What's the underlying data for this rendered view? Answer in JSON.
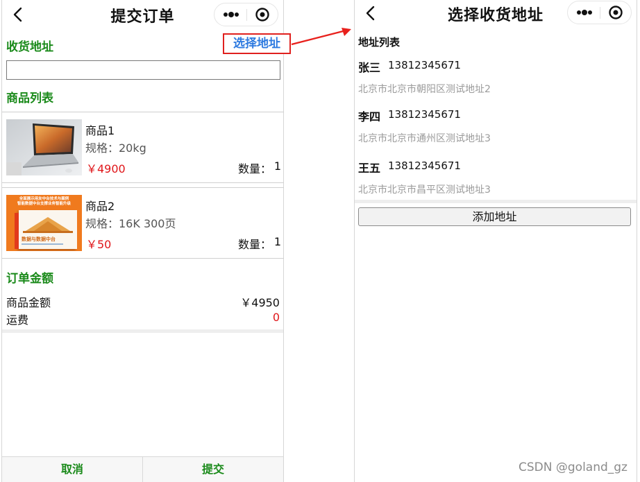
{
  "left_page": {
    "nav_title": "提交订单",
    "address_section_title": "收货地址",
    "select_address_label": "选择地址",
    "address_input_value": "",
    "products_section_title": "商品列表",
    "products": [
      {
        "name": "商品1",
        "spec": "规格：20kg",
        "price": "￥4900",
        "qty_label": "数量：",
        "qty": "1",
        "image": "laptop-image"
      },
      {
        "name": "商品2",
        "spec": "规格：16K 300页",
        "price": "￥50",
        "qty_label": "数量：",
        "qty": "1",
        "image": "book-cover-image"
      }
    ],
    "amount_section_title": "订单金额",
    "goods_amount_label": "商品金额",
    "goods_amount_value": "￥4950",
    "shipping_label": "运费",
    "shipping_value": "0",
    "cancel_label": "取消",
    "submit_label": "提交"
  },
  "right_page": {
    "nav_title": "选择收货地址",
    "list_heading": "地址列表",
    "addresses": [
      {
        "name": "张三",
        "phone": "13812345671",
        "detail": "北京市北京市朝阳区测试地址2"
      },
      {
        "name": "李四",
        "phone": "13812345671",
        "detail": "北京市北京市通州区测试地址3"
      },
      {
        "name": "王五",
        "phone": "13812345671",
        "detail": "北京市北京市昌平区测试地址3"
      }
    ],
    "add_address_label": "添加地址"
  },
  "book_cover_text": {
    "line1": "全面展示用友中台技术与案例",
    "line2": "智能数据中台支撑业务智能升级",
    "title": "数据与数据中台"
  },
  "colors": {
    "section_green": "#1a8a1a",
    "price_red": "#e0161a",
    "link_blue": "#2f7be0",
    "highlight_red": "#e0201e",
    "muted_gray": "#9a9a9a"
  },
  "icons": [
    "back-chevron-icon",
    "more-dots-icon",
    "close-target-icon",
    "arrow-icon"
  ],
  "watermark": "CSDN @goland_gz"
}
